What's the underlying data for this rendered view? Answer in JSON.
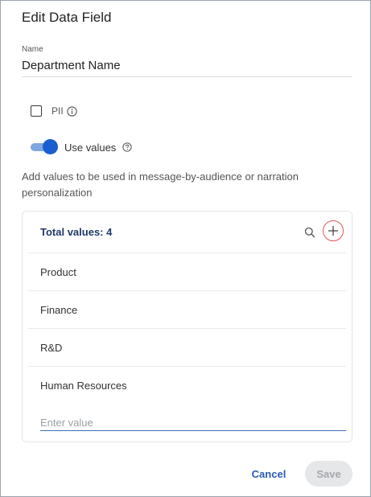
{
  "dialog": {
    "title": "Edit Data Field"
  },
  "name_field": {
    "label": "Name",
    "value": "Department Name"
  },
  "pii": {
    "label": "PII",
    "checked": false,
    "icon": "info-icon"
  },
  "use_values": {
    "label": "Use values",
    "enabled": true,
    "icon": "help-icon"
  },
  "description": "Add values to be used in message-by-audience or narration personalization",
  "values_panel": {
    "header": "Total values: 4",
    "items": [
      "Product",
      "Finance",
      "R&D",
      "Human Resources"
    ],
    "input_placeholder": "Enter value",
    "search_icon": "search-icon",
    "add_icon": "plus-icon"
  },
  "footer": {
    "cancel_label": "Cancel",
    "save_label": "Save"
  },
  "colors": {
    "accent": "#1a5ecf",
    "link": "#2a5bb5",
    "header_text": "#1f3a68",
    "highlight_ring": "#e05757"
  }
}
